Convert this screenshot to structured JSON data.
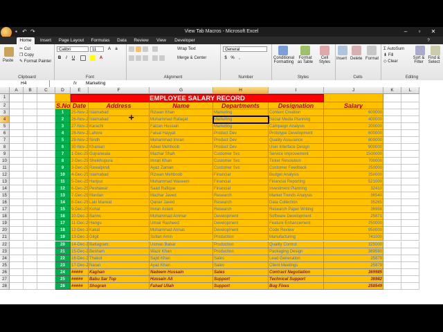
{
  "window": {
    "title": "View Tab Macros - Microsoft Excel",
    "minimize": "–",
    "maximize": "▫",
    "close": "✕"
  },
  "tabs": [
    "Home",
    "Insert",
    "Page Layout",
    "Formulas",
    "Data",
    "Review",
    "View",
    "Developer"
  ],
  "active_tab": "Home",
  "ribbon": {
    "clipboard": {
      "paste": "Paste",
      "cut": "Cut",
      "copy": "Copy",
      "format_painter": "Format Painter",
      "label": "Clipboard"
    },
    "font": {
      "name": "Calibri",
      "size": "11",
      "label": "Font"
    },
    "alignment": {
      "wrap_text": "Wrap Text",
      "merge_center": "Merge & Center",
      "label": "Alignment"
    },
    "number": {
      "format": "General",
      "label": "Number"
    },
    "styles": {
      "conditional": "Conditional Formatting",
      "format_table": "Format as Table",
      "cell_styles": "Cell Styles",
      "label": "Styles"
    },
    "cells": {
      "insert": "Insert",
      "delete": "Delete",
      "format": "Format",
      "label": "Cells"
    },
    "editing": {
      "autosum": "AutoSum",
      "fill": "Fill",
      "clear": "Clear",
      "sort_filter": "Sort & Filter",
      "find_select": "Find & Select",
      "label": "Editing"
    }
  },
  "formula_bar": {
    "name_box": "H4",
    "fx": "fx",
    "content": "Marketing"
  },
  "columns": [
    "A",
    "B",
    "C",
    "D",
    "E",
    "F",
    "G",
    "H",
    "I",
    "J",
    "K",
    "L"
  ],
  "selected_column": "H",
  "selected_row": 4,
  "sheet_title": "EMPLOYEE SALARY RECORD",
  "headers": [
    "S.No",
    "Date",
    "Address",
    "Name",
    "Departments",
    "Designation",
    "Salary"
  ],
  "rows": [
    {
      "n": "1",
      "date": "25-Nov-25",
      "addr": "Islamabad",
      "name": "Rizwan Khan",
      "dept": "Marketing",
      "desig": "Content Creation",
      "sal": "600000"
    },
    {
      "n": "2",
      "date": "26-Nov-25",
      "addr": "Islamabad",
      "name": "Muhammad Rafaqat",
      "dept": "Marketing",
      "desig": "Social Media Planning",
      "sal": "400000"
    },
    {
      "n": "3",
      "date": "27-Nov-25",
      "addr": "Karachi",
      "name": "Faizan Hussain",
      "dept": "Marketing",
      "desig": "Campaign Analysis",
      "sal": "200000"
    },
    {
      "n": "4",
      "date": "28-Nov-25",
      "addr": "Lahore",
      "name": "Faisal Hayyat",
      "dept": "Product Dev",
      "desig": "Prototype Development",
      "sal": "600000"
    },
    {
      "n": "5",
      "date": "29-Nov-25",
      "addr": "Sindh",
      "name": "Muhammad Imran",
      "dept": "Product Dev",
      "desig": "Quality Assurance",
      "sal": "800000"
    },
    {
      "n": "6",
      "date": "30-Nov-25",
      "addr": "Khanian",
      "name": "Adeel Mehboob",
      "dept": "Product Dev",
      "desig": "User Interface Design",
      "sal": "900000"
    },
    {
      "n": "7",
      "date": "1-Dec-25",
      "addr": "Gujranwala",
      "name": "Mazhar Shah",
      "dept": "Customer Svc",
      "desig": "Service Improvement",
      "sal": "1500000"
    },
    {
      "n": "8",
      "date": "2-Dec-25",
      "addr": "Sheikhupura",
      "name": "Imran Khan",
      "dept": "Customer Svc",
      "desig": "Ticket Resolution",
      "sal": "700000"
    },
    {
      "n": "9",
      "date": "3-Dec-25",
      "addr": "Rawalpindi",
      "name": "Ayaz Zaman",
      "dept": "Customer Svc",
      "desig": "Customer Feedback",
      "sal": "250000"
    },
    {
      "n": "10",
      "date": "4-Dec-25",
      "addr": "Islamabad",
      "name": "Rizwan Mehboob",
      "dept": "Financial",
      "desig": "Budget Analysis",
      "sal": "250000"
    },
    {
      "n": "11",
      "date": "5-Dec-25",
      "addr": "Haripur",
      "name": "Muhammad Waseem",
      "dept": "Financial",
      "desig": "Financial Reporting",
      "sal": "521000"
    },
    {
      "n": "12",
      "date": "6-Dec-25",
      "addr": "Peshawar",
      "name": "Saad Rafique",
      "dept": "Financial",
      "desig": "Investment Planning",
      "sal": "32410"
    },
    {
      "n": "13",
      "date": "7-Dec-25",
      "addr": "Mardan",
      "name": "Mazhar Javed",
      "dept": "Research",
      "desig": "Market Trends Analysis",
      "sal": "36540"
    },
    {
      "n": "14",
      "date": "8-Dec-25",
      "addr": "Laki Marwat",
      "name": "Qaiser Javed",
      "dept": "Research",
      "desig": "Data Collection",
      "sal": "35265"
    },
    {
      "n": "15",
      "date": "9-Dec-25",
      "addr": "Kohat",
      "name": "Imran Aslam",
      "dept": "Research",
      "desig": "Research Paper Writing",
      "sal": "36958"
    },
    {
      "n": "16",
      "date": "10-Dec-25",
      "addr": "Bannu",
      "name": "Muhammad Ammar",
      "dept": "Development",
      "desig": "Software Development",
      "sal": "25871"
    },
    {
      "n": "17",
      "date": "11-Dec-25",
      "addr": "Hangu",
      "name": "Umair Rasheed",
      "dept": "Development",
      "desig": "Feature Enhancement",
      "sal": "250000"
    },
    {
      "n": "18",
      "date": "12-Dec-25",
      "addr": "Kakat",
      "name": "Muhammad Annas",
      "dept": "Development",
      "desig": "Code Review",
      "sal": "950000"
    },
    {
      "n": "19",
      "date": "13-Dec-25",
      "addr": "Gilgit",
      "name": "Sultan Amin",
      "dept": "Production",
      "desig": "Manufacturing",
      "sal": "741000"
    },
    {
      "n": "20",
      "date": "14-Dec-25",
      "addr": "Battagram",
      "name": "Usman Babar",
      "dept": "Production",
      "desig": "Quality Control",
      "sal": "325000"
    },
    {
      "n": "21",
      "date": "15-Dec-25",
      "addr": "Besham",
      "name": "Wazir Khan",
      "dept": "Production",
      "desig": "Packaging Design",
      "sal": "369580"
    },
    {
      "n": "22",
      "date": "16-Dec-25",
      "addr": "Thakot",
      "name": "Sajid Khan",
      "dept": "Sales",
      "desig": "Lead Generation",
      "sal": "25879"
    },
    {
      "n": "23",
      "date": "17-Dec-25",
      "addr": "Naran",
      "name": "Ayaz Khan",
      "dept": "Sales",
      "desig": "Client Meetings",
      "sal": "25879"
    },
    {
      "n": "24",
      "date": "#####",
      "addr": "Kaghan",
      "name": "Nadeem Hussain",
      "dept": "Sales",
      "desig": "Contract Negotiation",
      "sal": "369985",
      "bold": true
    },
    {
      "n": "25",
      "date": "#####",
      "addr": "Babu Sar Top",
      "name": "Hussain Ali",
      "dept": "Support",
      "desig": "Technical Support",
      "sal": "36982",
      "bold": true
    },
    {
      "n": "26",
      "date": "#####",
      "addr": "Shogran",
      "name": "Fahad Ullah",
      "dept": "Support",
      "desig": "Bug Fixes",
      "sal": "258549",
      "bold": true
    }
  ]
}
